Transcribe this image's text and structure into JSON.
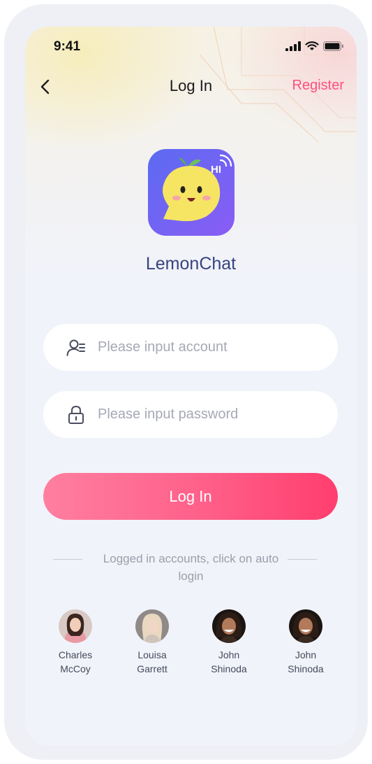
{
  "status_bar": {
    "time": "9:41",
    "icons": [
      "signal-icon",
      "wifi-icon",
      "battery-icon"
    ]
  },
  "nav": {
    "title": "Log In",
    "register_label": "Register",
    "back_icon": "chevron-left-icon"
  },
  "app": {
    "name": "LemonChat",
    "logo_badge": "HI"
  },
  "form": {
    "account_placeholder": "Please input account",
    "account_value": "",
    "password_placeholder": "Please input password",
    "password_value": "",
    "login_label": "Log In"
  },
  "saved": {
    "caption": "Logged in accounts, click on auto login",
    "accounts": [
      {
        "name": "Charles\nMcCoy"
      },
      {
        "name": "Louisa\nGarrett"
      },
      {
        "name": "John\nShinoda"
      },
      {
        "name": "John\nShinoda"
      }
    ]
  },
  "colors": {
    "accent": "#ff4f7e",
    "title_blue": "#38437e",
    "logo_gradient": [
      "#5b6bf2",
      "#8a5cf5"
    ],
    "button_gradient": [
      "#ff7fa0",
      "#ff3e6e"
    ]
  }
}
